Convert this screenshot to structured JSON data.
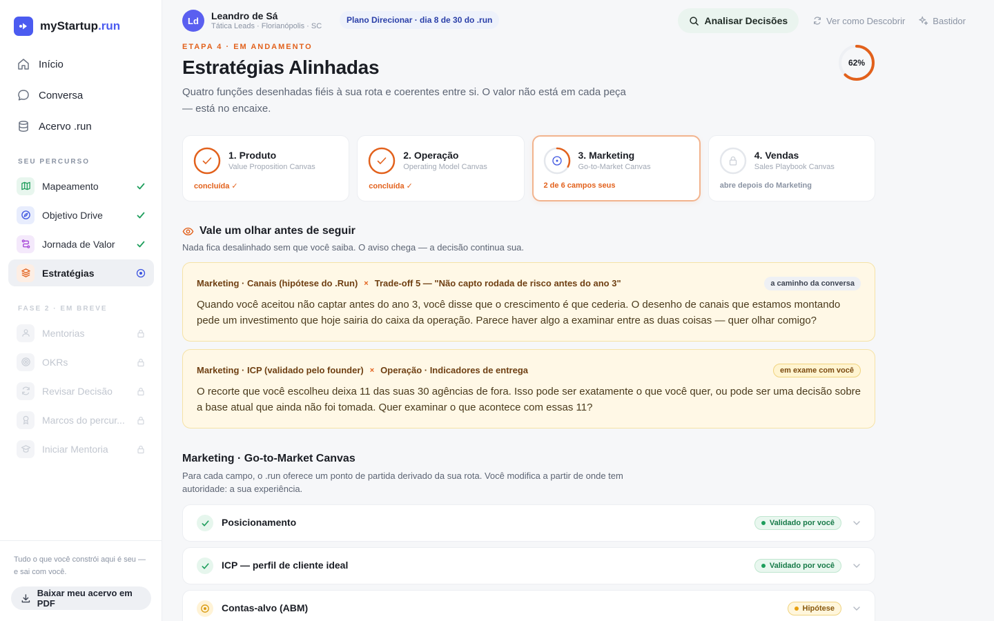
{
  "app": {
    "name_main": "myStartup",
    "name_accent": ".run"
  },
  "nav": {
    "main": [
      {
        "label": "Início",
        "icon": "home-icon"
      },
      {
        "label": "Conversa",
        "icon": "chat-icon"
      },
      {
        "label": "Acervo .run",
        "icon": "database-icon"
      }
    ],
    "journey_label": "SEU PERCURSO",
    "journey": [
      {
        "label": "Mapeamento",
        "icon": "map-icon"
      },
      {
        "label": "Objetivo Drive",
        "icon": "compass-icon"
      },
      {
        "label": "Jornada de Valor",
        "icon": "route-icon"
      },
      {
        "label": "Estratégias",
        "icon": "layers-icon"
      }
    ],
    "phase2_label": "FASE 2 · EM BREVE",
    "phase2": [
      {
        "label": "Mentorias"
      },
      {
        "label": "OKRs"
      },
      {
        "label": "Revisar Decisão"
      },
      {
        "label": "Marcos do percur..."
      },
      {
        "label": "Iniciar Mentoria"
      }
    ],
    "footer_text": "Tudo o que você constrói aqui é seu — e sai com você.",
    "pdf_button": "Baixar meu acervo em PDF"
  },
  "topbar": {
    "avatar_initials": "Ld",
    "user_name": "Leandro de Sá",
    "user_sub": "Tática Leads · Florianópolis · SC",
    "plan": "Plano Direcionar · dia 8 de 30 do .run",
    "analyze_button": "Analisar Decisões",
    "view_as": "Ver como Descobrir",
    "backstage": "Bastidor"
  },
  "header": {
    "eyebrow": "ETAPA 4 · EM ANDAMENTO",
    "title": "Estratégias Alinhadas",
    "description": "Quatro funções desenhadas fiéis à sua rota e coerentes entre si. O valor não está em cada peça — está no encaixe.",
    "progress_label": "62%",
    "progress_value": 0.62
  },
  "cards": [
    {
      "title": "1. Produto",
      "sub": "Value Proposition Canvas",
      "status": "concluída ✓"
    },
    {
      "title": "2. Operação",
      "sub": "Operating Model Canvas",
      "status": "concluída ✓"
    },
    {
      "title": "3. Marketing",
      "sub": "Go-to-Market Canvas",
      "status": "2 de 6 campos seus",
      "progress": 0.33
    },
    {
      "title": "4. Vendas",
      "sub": "Sales Playbook Canvas",
      "status": "abre depois do Marketing"
    }
  ],
  "alerts": {
    "title": "Vale um olhar antes de seguir",
    "subtitle": "Nada fica desalinhado sem que você saiba. O aviso chega — a decisão continua sua.",
    "items": [
      {
        "left": "Marketing · Canais (hipótese do .Run)",
        "sep": "×",
        "right": "Trade-off 5 — \"Não capto rodada de risco antes do ano 3\"",
        "badge": "a caminho da conversa",
        "body": "Quando você aceitou não captar antes do ano 3, você disse que o crescimento é que cederia. O desenho de canais que estamos montando pede um investimento que hoje sairia do caixa da operação. Parece haver algo a examinar entre as duas coisas — quer olhar comigo?"
      },
      {
        "left": "Marketing · ICP (validado pelo founder)",
        "sep": "×",
        "right": "Operação · Indicadores de entrega",
        "badge": "em exame com você",
        "body": "O recorte que você escolheu deixa 11 das suas 30 agências de fora. Isso pode ser exatamente o que você quer, ou pode ser uma decisão sobre a base atual que ainda não foi tomada. Quer examinar o que acontece com essas 11?"
      }
    ]
  },
  "canvas": {
    "title": "Marketing · Go-to-Market Canvas",
    "description": "Para cada campo, o .run oferece um ponto de partida derivado da sua rota. Você modifica a partir de onde tem autoridade: a sua experiência.",
    "fields": [
      {
        "label": "Posicionamento",
        "badge": "Validado por você"
      },
      {
        "label": "ICP — perfil de cliente ideal",
        "badge": "Validado por você"
      },
      {
        "label": "Contas-alvo (ABM)",
        "badge": "Hipótese"
      }
    ]
  },
  "colors": {
    "accent": "#4b5bf0",
    "orange": "#e2611c",
    "green": "#1e9e5c"
  }
}
